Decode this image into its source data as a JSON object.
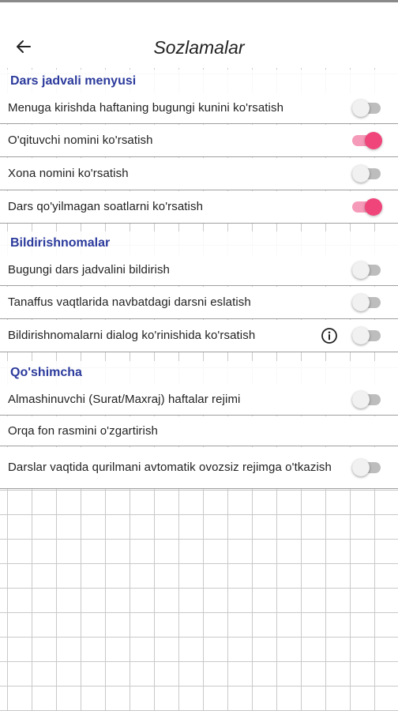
{
  "header": {
    "title": "Sozlamalar",
    "back_icon": "arrow-left-icon"
  },
  "colors": {
    "accent": "#f0457a",
    "accent_track": "#f59ab8",
    "section_header": "#2b3a9c",
    "toggle_off": "#bdbdbd"
  },
  "sections": [
    {
      "title": "Dars jadvali menyusi",
      "items": [
        {
          "label": "Menuga kirishda haftaning bugungi kunini ko'rsatish",
          "toggle": false
        },
        {
          "label": "O'qituvchi nomini ko'rsatish",
          "toggle": true
        },
        {
          "label": "Xona nomini ko'rsatish",
          "toggle": false
        },
        {
          "label": "Dars qo'yilmagan soatlarni ko'rsatish",
          "toggle": true
        }
      ]
    },
    {
      "title": "Bildirishnomalar",
      "items": [
        {
          "label": "Bugungi dars jadvalini bildirish",
          "toggle": false
        },
        {
          "label": "Tanaffus vaqtlarida navbatdagi darsni eslatish",
          "toggle": false
        },
        {
          "label": "Bildirishnomalarni dialog ko'rinishida ko'rsatish",
          "toggle": false,
          "info_icon": "info-icon"
        }
      ]
    },
    {
      "title": "Qo'shimcha",
      "items": [
        {
          "label": "Almashinuvchi (Surat/Maxraj) haftalar rejimi",
          "toggle": false
        },
        {
          "label": "Orqa fon rasmini o'zgartirish"
        },
        {
          "label": "Darslar vaqtida qurilmani avtomatik ovozsiz rejimga o'tkazish",
          "toggle": false
        }
      ]
    }
  ]
}
